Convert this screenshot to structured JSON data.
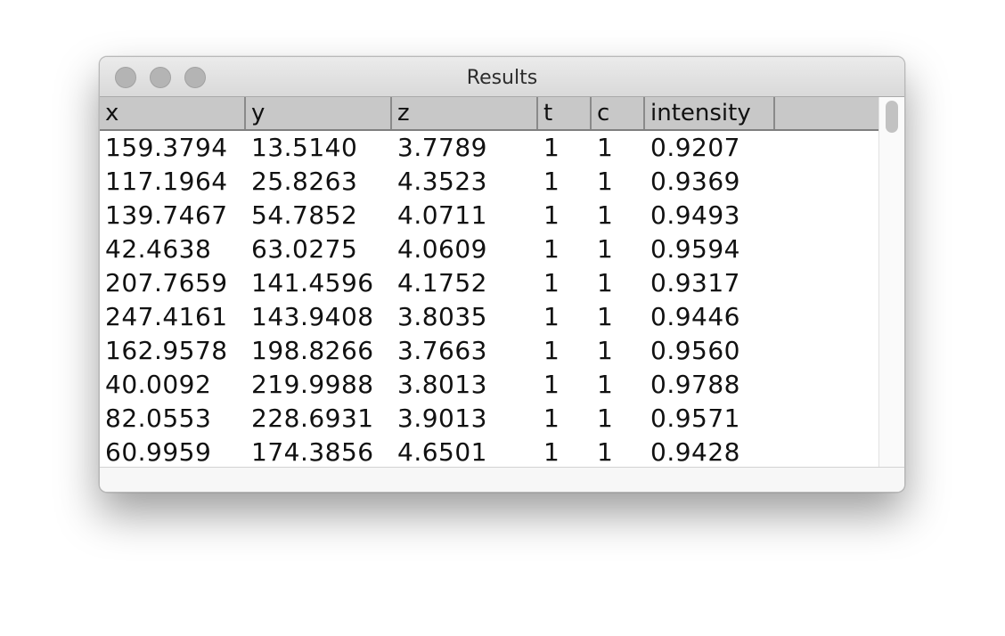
{
  "window": {
    "title": "Results"
  },
  "table": {
    "columns": [
      "x",
      "y",
      "z",
      "t",
      "c",
      "intensity",
      ""
    ],
    "rows": [
      [
        "159.3794",
        "13.5140",
        "3.7789",
        "1",
        "1",
        "0.9207"
      ],
      [
        "117.1964",
        "25.8263",
        "4.3523",
        "1",
        "1",
        "0.9369"
      ],
      [
        "139.7467",
        "54.7852",
        "4.0711",
        "1",
        "1",
        "0.9493"
      ],
      [
        "42.4638",
        "63.0275",
        "4.0609",
        "1",
        "1",
        "0.9594"
      ],
      [
        "207.7659",
        "141.4596",
        "4.1752",
        "1",
        "1",
        "0.9317"
      ],
      [
        "247.4161",
        "143.9408",
        "3.8035",
        "1",
        "1",
        "0.9446"
      ],
      [
        "162.9578",
        "198.8266",
        "3.7663",
        "1",
        "1",
        "0.9560"
      ],
      [
        "40.0092",
        "219.9988",
        "3.8013",
        "1",
        "1",
        "0.9788"
      ],
      [
        "82.0553",
        "228.6931",
        "3.9013",
        "1",
        "1",
        "0.9571"
      ],
      [
        "60.9959",
        "174.3856",
        "4.6501",
        "1",
        "1",
        "0.9428"
      ]
    ]
  },
  "colors": {
    "header_bg": "#c8c8c8",
    "window_bg": "#ececec",
    "traffic_light": "#b4b4b4"
  }
}
